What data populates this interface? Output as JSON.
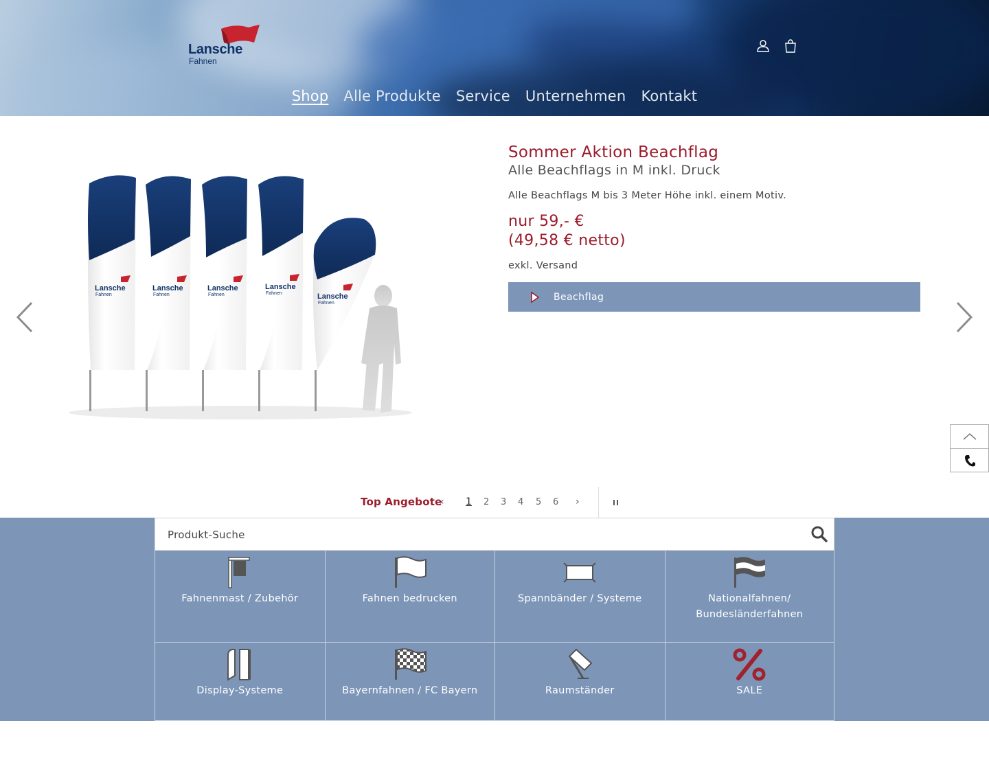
{
  "header": {
    "logo": {
      "brand": "Lansche",
      "sub": "Fahnen"
    },
    "icons": [
      "account-icon",
      "cart-icon"
    ],
    "nav": [
      {
        "label": "Shop",
        "active": true
      },
      {
        "label": "Alle Produkte"
      },
      {
        "label": "Service"
      },
      {
        "label": "Unternehmen"
      },
      {
        "label": "Kontakt"
      }
    ]
  },
  "slide": {
    "title": "Sommer Aktion Beachflag",
    "subtitle": "Alle Beachflags in M inkl. Druck",
    "description": "Alle Beachflags M bis 3 Meter Höhe inkl. einem Motiv.",
    "price_line1": "nur 59,- €",
    "price_line2": "(49,58 € netto)",
    "shipping": "exkl. Versand",
    "button_label": "Beachflag",
    "flag_logo_text": "Lansche",
    "flag_logo_sub": "Fahnen"
  },
  "pager": {
    "label": "Top Angebote",
    "prev": "‹",
    "next": "›",
    "pages": [
      "1",
      "2",
      "3",
      "4",
      "5",
      "6"
    ],
    "active_page": "1"
  },
  "search": {
    "placeholder": "Produkt-Suche"
  },
  "categories": [
    {
      "label": "Fahnenmast / Zubehör",
      "icon": "flagpole-icon"
    },
    {
      "label": "Fahnen bedrucken",
      "icon": "flag-icon"
    },
    {
      "label": "Spannbänder / Systeme",
      "icon": "banner-frame-icon"
    },
    {
      "label": "Nationalfahnen/ Bundesländerfahnen",
      "icon": "national-flag-icon"
    },
    {
      "label": "Display-Systeme",
      "icon": "display-system-icon"
    },
    {
      "label": "Bayernfahnen / FC Bayern",
      "icon": "checkered-flag-icon"
    },
    {
      "label": "Raumständer",
      "icon": "room-stand-icon"
    },
    {
      "label": "SALE",
      "icon": "percent-icon"
    }
  ],
  "colors": {
    "brand_red": "#9b1c2b",
    "accent_blue": "#7d96b8",
    "logo_navy": "#0f3166"
  }
}
